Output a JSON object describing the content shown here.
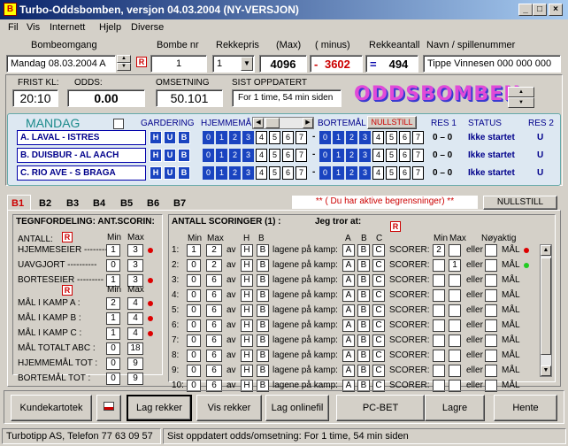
{
  "window": {
    "title": "Turbo-Oddsbomben, versjon 04.03.2004 (NY-VERSJON)",
    "icon_text": "B"
  },
  "menu": [
    "Fil",
    "Vis",
    "Internett",
    "Hjelp",
    "Diverse"
  ],
  "top_labels": {
    "bombeomgang": "Bombeomgang",
    "bombe_nr": "Bombe nr",
    "rekkepris": "Rekkepris",
    "max": "(Max)",
    "minus": "( minus)",
    "rekkeantall": "Rekkeantall",
    "navn": "Navn / spillenummer"
  },
  "top_values": {
    "bombeomgang": "Mandag  08.03.2004 A",
    "bombe_nr": "1",
    "rekkepris": "1",
    "max": "4096",
    "minus_sign": "-",
    "minus": "3602",
    "eq": "=",
    "rekkeantall": "494",
    "navn": "Tippe Vinnesen 000 000 000"
  },
  "info": {
    "frist_label": "FRIST KL:",
    "frist": "20:10",
    "odds_label": "ODDS:",
    "odds": "0.00",
    "omsetning_label": "OMSETNING",
    "omsetning": "50.101",
    "sist_label": "SIST OPPDATERT",
    "sist": "For 1 time, 54 min siden"
  },
  "logo": "ODDSBOMBEN",
  "games": {
    "day": "MANDAG",
    "headers": {
      "gardering": "GARDERING",
      "hjemmemal": "HJEMMEMÅL",
      "bortemal": "BORTEMÅL",
      "nullstill": "NULLSTILL",
      "res1": "RES 1",
      "status": "STATUS",
      "res2": "RES 2"
    },
    "hub": [
      "H",
      "U",
      "B"
    ],
    "numbers": [
      "0",
      "1",
      "2",
      "3",
      "4",
      "5",
      "6",
      "7"
    ],
    "rows": [
      {
        "name": "A. LAVAL       - ISTRES",
        "sep": "-",
        "res1": "0 – 0",
        "status": "Ikke startet",
        "res2": "U"
      },
      {
        "name": "B. DUISBUR   - AL AACH",
        "sep": "-",
        "res1": "0 – 0",
        "status": "Ikke startet",
        "res2": "U"
      },
      {
        "name": "C. RIO AVE    - S BRAGA",
        "sep": "-",
        "res1": "0 – 0",
        "status": "Ikke startet",
        "res2": "U"
      }
    ]
  },
  "tabs": [
    "B1",
    "B2",
    "B3",
    "B4",
    "B5",
    "B6",
    "B7"
  ],
  "warning": "** ( Du har aktive begrensninger) **",
  "nullstill_btn": "NULLSTILL",
  "left": {
    "title": "TEGNFORDELING: ANT.SCORIN:",
    "antall": "ANTALL:",
    "min": "Min",
    "max": "Max",
    "rows1": [
      {
        "label": "HJEMMESEIER --------",
        "min": "1",
        "max": "3",
        "dot": true
      },
      {
        "label": "UAVGJORT ----------",
        "min": "0",
        "max": "3",
        "dot": false
      },
      {
        "label": "BORTESEIER ---------",
        "min": "1",
        "max": "3",
        "dot": true
      }
    ],
    "rows2": [
      {
        "label": "MÅL I KAMP A :",
        "min": "2",
        "max": "4",
        "dot": true
      },
      {
        "label": "MÅL I KAMP B :",
        "min": "1",
        "max": "4",
        "dot": true
      },
      {
        "label": "MÅL I KAMP C :",
        "min": "1",
        "max": "4",
        "dot": true
      },
      {
        "label": "MÅL TOTALT ABC :",
        "min": "0",
        "max": "18",
        "dot": false
      },
      {
        "label": "HJEMMEMÅL  TOT :",
        "min": "0",
        "max": "9",
        "dot": false
      },
      {
        "label": "BORTEMÅL  TOT :",
        "min": "0",
        "max": "9",
        "dot": false
      }
    ]
  },
  "right": {
    "title": "ANTALL SCORINGER (1) :",
    "jeg": "Jeg tror at:",
    "headers": {
      "min": "Min",
      "max": "Max",
      "h": "H",
      "b": "B",
      "a": "A",
      "bb": "B",
      "c": "C",
      "min2": "Min",
      "max2": "Max",
      "noyaktig": "Nøyaktig"
    },
    "av": "av",
    "lagene": "lagene på kamp:",
    "scorer": "SCORER:",
    "eller": "eller",
    "mal": "MÅL",
    "rows": [
      {
        "n": "1:",
        "min": "1",
        "max": "2",
        "smin": "2",
        "smax": "",
        "dot": "red"
      },
      {
        "n": "2:",
        "min": "0",
        "max": "2",
        "smin": "",
        "smax": "1",
        "dot": "green"
      },
      {
        "n": "3:",
        "min": "0",
        "max": "6",
        "smin": "",
        "smax": "",
        "dot": ""
      },
      {
        "n": "4:",
        "min": "0",
        "max": "6",
        "smin": "",
        "smax": "",
        "dot": ""
      },
      {
        "n": "5:",
        "min": "0",
        "max": "6",
        "smin": "",
        "smax": "",
        "dot": ""
      },
      {
        "n": "6:",
        "min": "0",
        "max": "6",
        "smin": "",
        "smax": "",
        "dot": ""
      },
      {
        "n": "7:",
        "min": "0",
        "max": "6",
        "smin": "",
        "smax": "",
        "dot": ""
      },
      {
        "n": "8:",
        "min": "0",
        "max": "6",
        "smin": "",
        "smax": "",
        "dot": ""
      },
      {
        "n": "9:",
        "min": "0",
        "max": "6",
        "smin": "",
        "smax": "",
        "dot": ""
      },
      {
        "n": "10:",
        "min": "0",
        "max": "6",
        "smin": "",
        "smax": "",
        "dot": ""
      }
    ]
  },
  "buttons": {
    "kundekartotek": "Kundekartotek",
    "lag_rekker": "Lag rekker",
    "vis_rekker": "Vis rekker",
    "lag_onlinefil": "Lag onlinefil",
    "pcbet": "PC-BET",
    "lagre": "Lagre",
    "hente": "Hente"
  },
  "status": {
    "left": "Turbotipp AS, Telefon 77 63 09 57",
    "right": "Sist oppdatert odds/omsetning: For 1 time, 54 min siden"
  }
}
